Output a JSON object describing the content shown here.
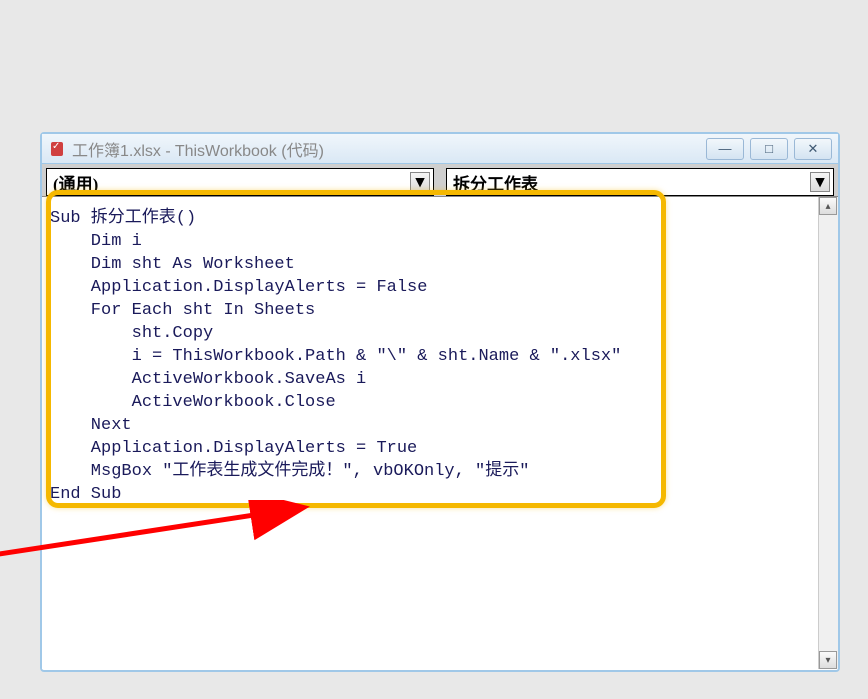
{
  "window": {
    "title": "工作簿1.xlsx - ThisWorkbook (代码)"
  },
  "dropdowns": {
    "left": "(通用)",
    "right": "拆分工作表"
  },
  "code_lines": [
    "Sub 拆分工作表()",
    "    Dim i",
    "    Dim sht As Worksheet",
    "    Application.DisplayAlerts = False",
    "    For Each sht In Sheets",
    "        sht.Copy",
    "        i = ThisWorkbook.Path & \"\\\" & sht.Name & \".xlsx\"",
    "        ActiveWorkbook.SaveAs i",
    "        ActiveWorkbook.Close",
    "    Next",
    "    Application.DisplayAlerts = True",
    "    MsgBox \"工作表生成文件完成！\", vbOKOnly, \"提示\"",
    "End Sub"
  ],
  "controls": {
    "minimize": "—",
    "maximize": "□",
    "close": "✕"
  }
}
